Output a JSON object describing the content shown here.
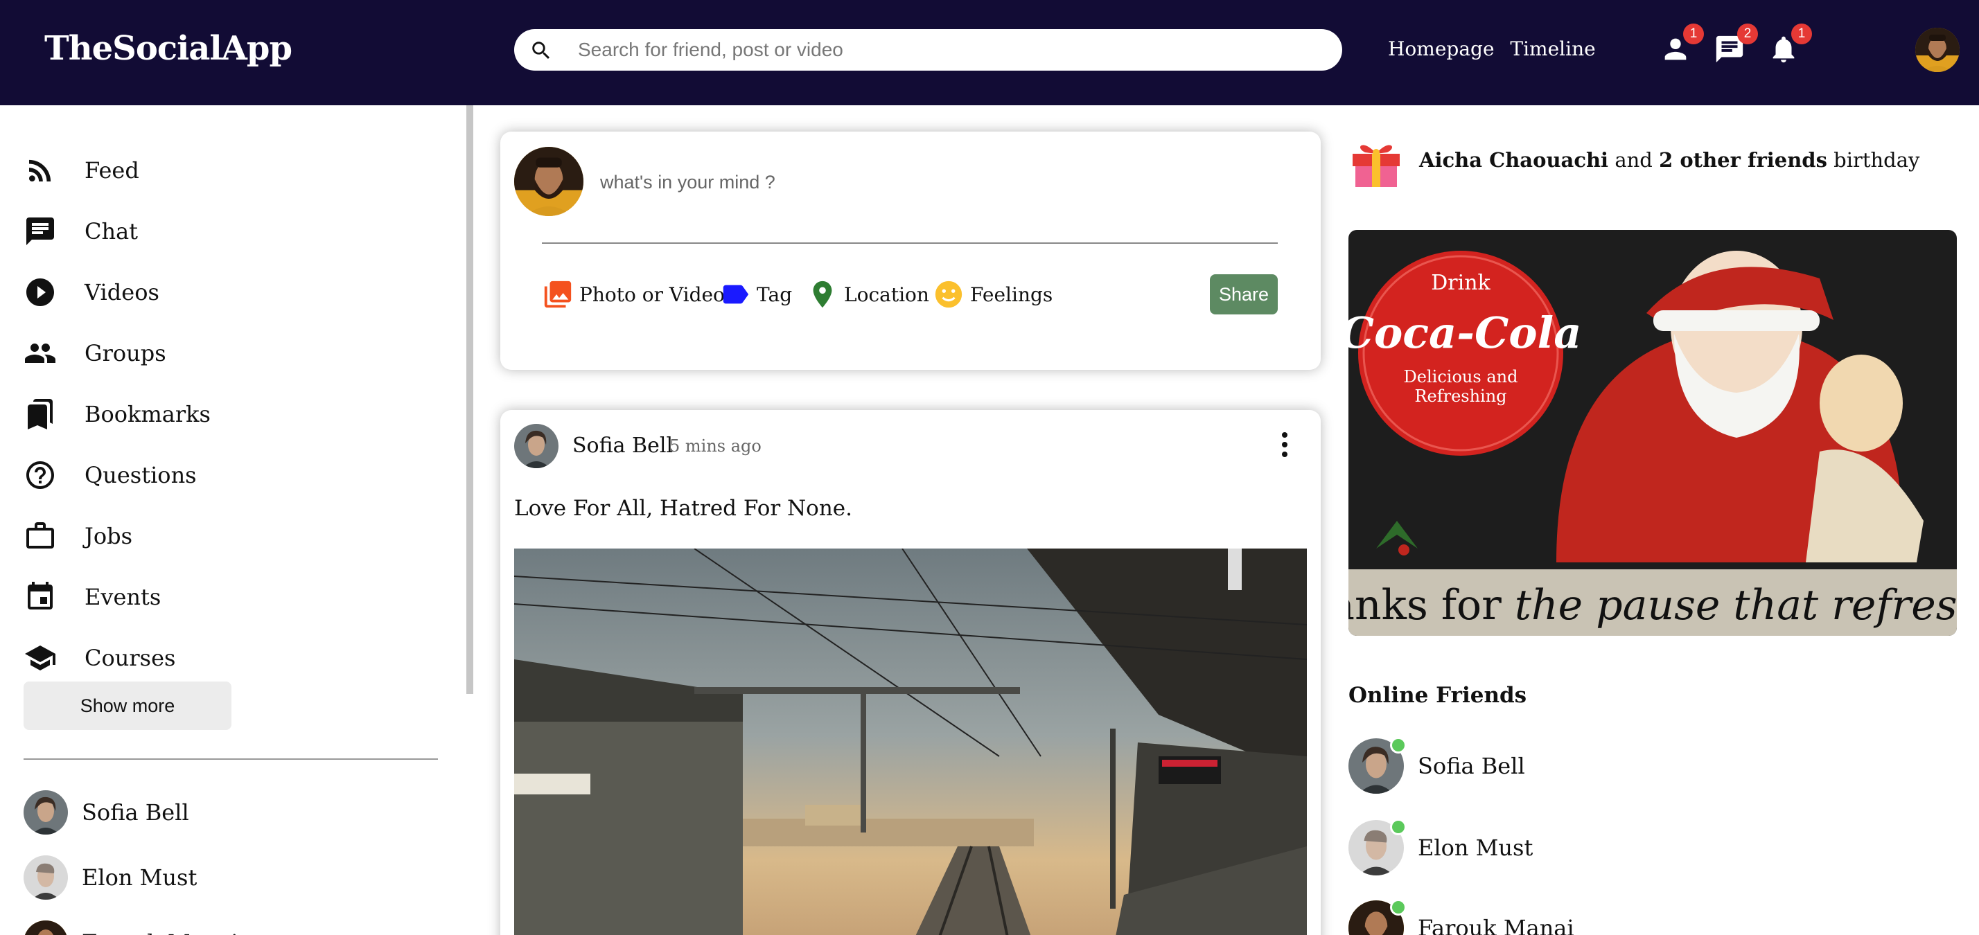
{
  "app": {
    "logo": "TheSocialApp"
  },
  "search": {
    "placeholder": "Search for friend, post or video"
  },
  "nav": {
    "links": [
      "Homepage",
      "Timeline"
    ]
  },
  "notifications": {
    "friend_requests": "1",
    "messages": "2",
    "alerts": "1"
  },
  "sidebar": {
    "items": [
      {
        "label": "Feed",
        "icon": "rss-feed-icon"
      },
      {
        "label": "Chat",
        "icon": "chat-icon"
      },
      {
        "label": "Videos",
        "icon": "play-circle-icon"
      },
      {
        "label": "Groups",
        "icon": "group-icon"
      },
      {
        "label": "Bookmarks",
        "icon": "bookmark-icon"
      },
      {
        "label": "Questions",
        "icon": "help-circle-icon"
      },
      {
        "label": "Jobs",
        "icon": "briefcase-icon"
      },
      {
        "label": "Events",
        "icon": "calendar-icon"
      },
      {
        "label": "Courses",
        "icon": "school-icon"
      }
    ],
    "show_more": "Show more",
    "friends": [
      "Sofia Bell",
      "Elon Must",
      "Farouk Manai"
    ]
  },
  "share": {
    "placeholder": "what's in your mind ?",
    "options": [
      "Photo or Video",
      "Tag",
      "Location",
      "Feelings"
    ],
    "button": "Share"
  },
  "post": {
    "username": "Sofia Bell",
    "time": "5 mins ago",
    "text": "Love For All, Hatred For None."
  },
  "rightbar": {
    "birthday": {
      "name": "Aicha Chaouachi",
      "joiner": "and",
      "others": "2 other friends",
      "suffix": "birthday"
    },
    "ad": {
      "brand_top": "Drink",
      "brand": "Coca-Cola",
      "brand_sub1": "Delicious and",
      "brand_sub2": "Refreshing",
      "slogan_a": "“Thanks for ",
      "slogan_b": "the pause that refreshes”"
    },
    "online_title": "Online Friends",
    "online": [
      "Sofia Bell",
      "Elon Must",
      "Farouk Manai"
    ]
  },
  "colors": {
    "topbar": "#120c35",
    "share_button": "#5d8a62",
    "badge": "#e53935",
    "online": "#5bc95b",
    "photo_icon": "#f4511e",
    "tag_icon": "#1a1aff",
    "location_icon": "#2e7d32",
    "feelings_icon": "#fbc02d"
  }
}
